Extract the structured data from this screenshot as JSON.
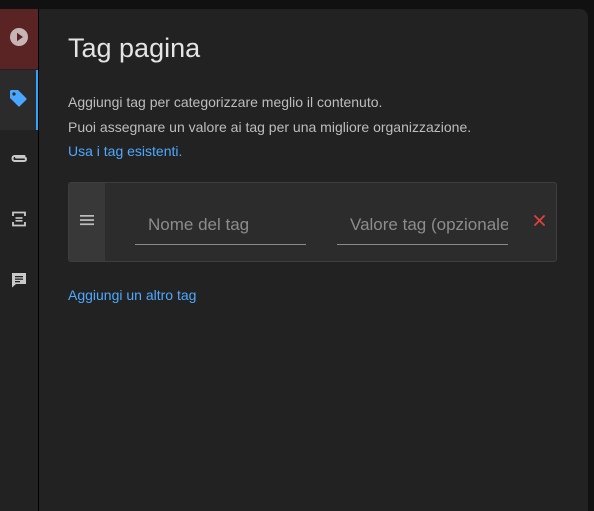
{
  "sidebar": {
    "items": [
      {
        "icon": "play-circle-icon",
        "active": false
      },
      {
        "icon": "tag-icon",
        "active": true
      },
      {
        "icon": "paperclip-icon",
        "active": false
      },
      {
        "icon": "template-icon",
        "active": false
      },
      {
        "icon": "comment-icon",
        "active": false
      }
    ]
  },
  "panel": {
    "title": "Tag pagina",
    "description_line1": "Aggiungi tag per categorizzare meglio il contenuto.",
    "description_line2": "Puoi assegnare un valore ai tag per una migliore organizzazione.",
    "existing_tags_link": "Usa i tag esistenti."
  },
  "tag_row": {
    "name_placeholder": "Nome del tag",
    "name_value": "",
    "value_placeholder": "Valore tag (opzionale)",
    "value_value": ""
  },
  "add_tag_link": "Aggiungi un altro tag",
  "colors": {
    "accent": "#4ea8ff",
    "active_rail_border": "#2ea3ff",
    "play_button_bg": "#5a2424",
    "remove_icon": "#e0413d",
    "panel_bg": "#222222"
  }
}
